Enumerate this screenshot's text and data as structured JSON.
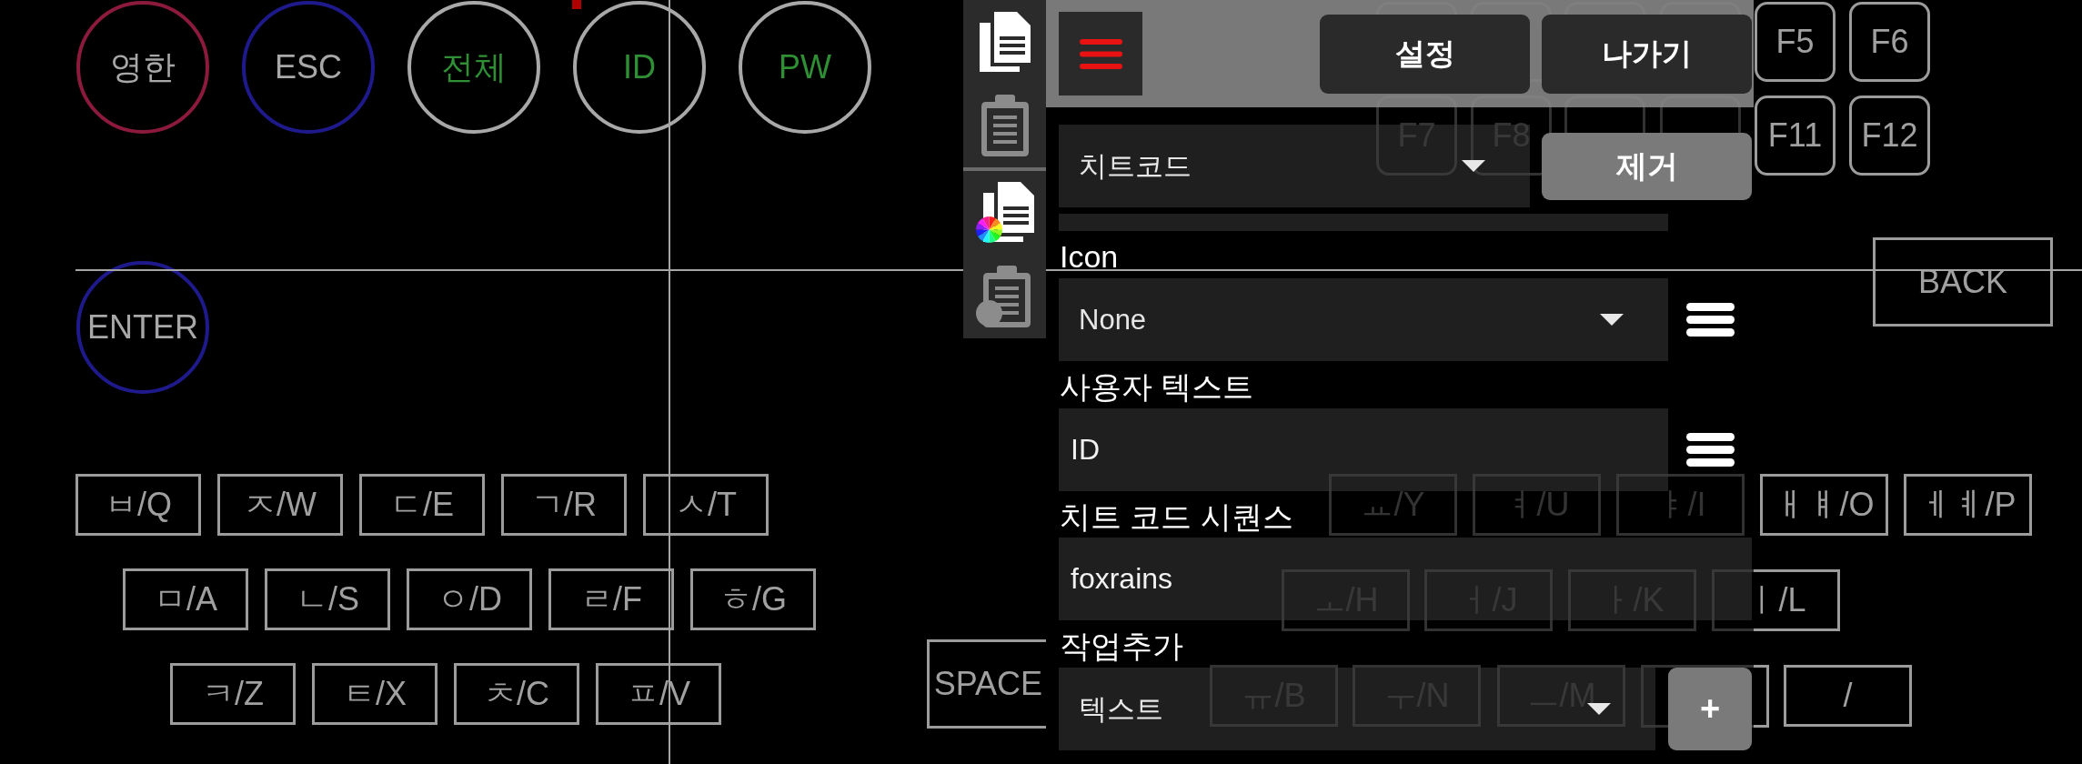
{
  "keyboard": {
    "round_keys": [
      {
        "label": "영한",
        "kind": "key",
        "color": "#8b1a3d"
      },
      {
        "label": "ESC",
        "kind": "key",
        "color": "#1e1a8c"
      },
      {
        "label": "전체",
        "kind": "macro",
        "color": "#a8a8a8"
      },
      {
        "label": "ID",
        "kind": "macro",
        "color": "#a8a8a8"
      },
      {
        "label": "PW",
        "kind": "macro",
        "color": "#a8a8a8"
      },
      {
        "label": "ENTER",
        "kind": "key",
        "color": "#1e1a8c"
      }
    ],
    "function_keys": [
      "F5",
      "F6",
      "F7",
      "F8",
      "F11",
      "F12"
    ],
    "wide_keys": [
      "BACK",
      "SPACE"
    ],
    "letter_keys": [
      "ㅂ/Q",
      "ㅈ/W",
      "ㄷ/E",
      "ㄱ/R",
      "ㅅ/T",
      "ㅛ/Y",
      "ㅕ/U",
      "ㅑ/I",
      "ㅐㅒ/O",
      "ㅔㅖ/P",
      "ㅁ/A",
      "ㄴ/S",
      "ㅇ/D",
      "ㄹ/F",
      "ㅎ/G",
      "ㅗ/H",
      "ㅓ/J",
      "ㅏ/K",
      "ㅣ/L",
      "ㅋ/Z",
      "ㅌ/X",
      "ㅊ/C",
      "ㅍ/V",
      "ㅠ/B",
      "ㅜ/N",
      "ㅡ/M",
      "/"
    ]
  },
  "editor": {
    "tools": [
      {
        "kind": "copy",
        "disabled": false
      },
      {
        "kind": "paste",
        "disabled": true
      },
      {
        "kind": "copy_color",
        "disabled": false
      },
      {
        "kind": "paste_color",
        "disabled": true
      }
    ],
    "header_buttons": [
      "설정",
      "나가기"
    ],
    "action": {
      "value": "치트코드",
      "button": "제거"
    },
    "icon": {
      "label": "Icon",
      "value": "None"
    },
    "user_text": {
      "label": "사용자 텍스트",
      "value": "ID"
    },
    "sequence": {
      "label": "치트 코드 시퀀스",
      "value": "foxrains"
    },
    "add_action": {
      "label": "작업추가",
      "value": "텍스트",
      "button": "+"
    }
  }
}
